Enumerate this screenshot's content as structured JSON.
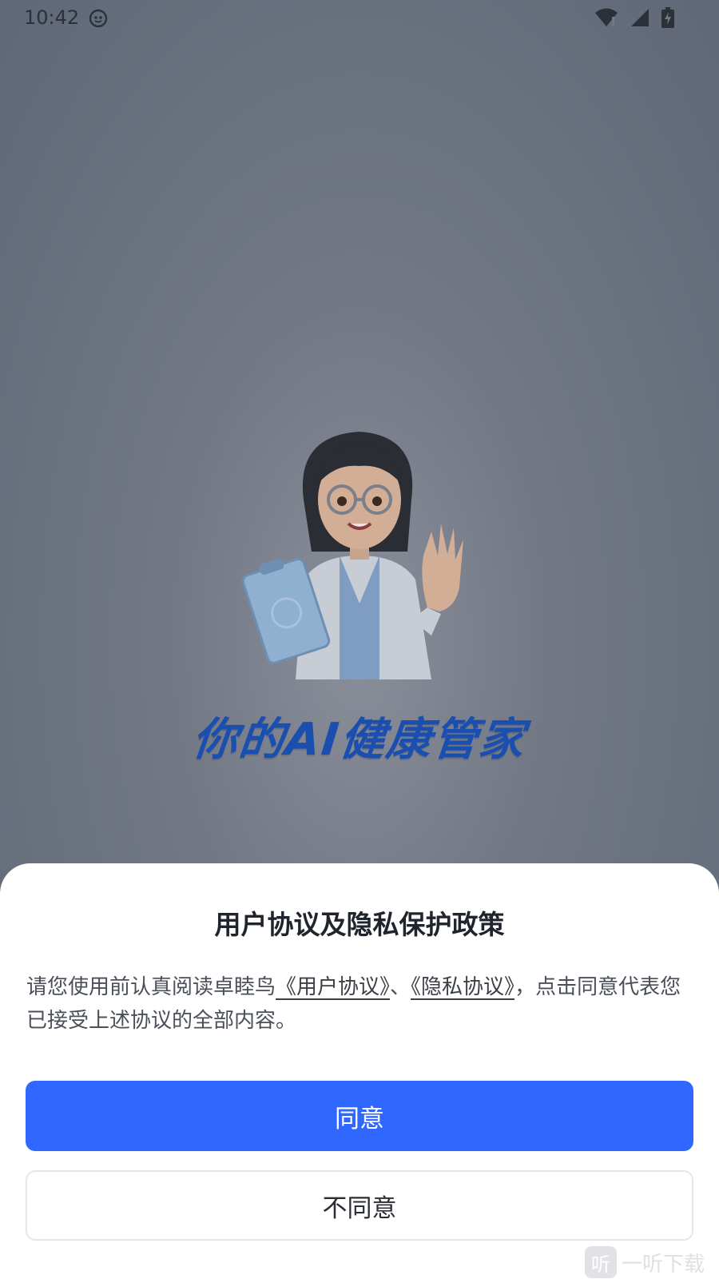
{
  "status_bar": {
    "time": "10:42"
  },
  "splash": {
    "slogan": "你的AI健康管家"
  },
  "dialog": {
    "title": "用户协议及隐私保护政策",
    "body_prefix": "请您使用前认真阅读卓睦鸟",
    "user_agreement_link": "《用户协议》",
    "separator": "、",
    "privacy_link": "《隐私协议》",
    "body_suffix": "，点击同意代表您已接受上述协议的全部内容。",
    "agree_label": "同意",
    "disagree_label": "不同意"
  },
  "watermark": {
    "logo_glyph": "听",
    "text": "一听下载"
  },
  "colors": {
    "primary": "#2f67ff",
    "slogan": "#1a4fb0",
    "overlay": "#5f6878"
  }
}
